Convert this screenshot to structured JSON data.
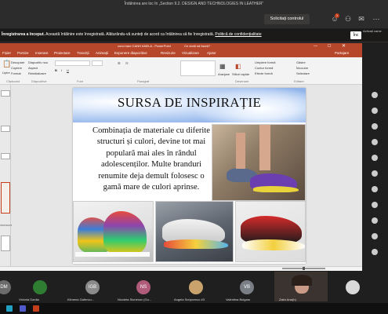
{
  "teams": {
    "meeting_title": "Întâlnirea are loc în „Section 9.2. DESIGN AND TECHNOLOGIES IN LEATHER”",
    "request_control_label": "Solicitați controlul",
    "notification_count": "1",
    "recording_banner": {
      "bold": "Înregistrarea a început.",
      "text": "Această întâlnire este înregistrată. Alăturându-vă sunteți de acord ca întâlnirea să fie înregistrată.",
      "link": "Politică de confidențialitate",
      "close_label": "Înc",
      "dismiss": "×"
    },
    "activate_label": "Activați came"
  },
  "powerpoint": {
    "title": "conc.hare CANH ANELA - PowerPoint",
    "window_search": "Ce doriți să faceți?",
    "user": "Partajare",
    "tabs": [
      "Fișier",
      "Pornire",
      "Inserare",
      "Proiectare",
      "Tranziții",
      "Animații",
      "Expunere diapozitive",
      "Revizuire",
      "Vizualizare",
      "Ajutor"
    ],
    "ribbon": {
      "paste": "Lipire",
      "clipboard_items": [
        "Decupare",
        "Copiere",
        "Format"
      ],
      "new_slide": "Diapozitiv nou",
      "slide_items": [
        "Aspect",
        "Reinițializare",
        "Secțiune"
      ],
      "group_clipboard": "Clipboard",
      "group_slides": "Diapozitive",
      "group_font": "Font",
      "group_paragraph": "Paragraf",
      "group_drawing": "Desenare",
      "group_editing": "Editare",
      "arrange": "Aranjare",
      "quick_styles": "Stiluri rapide",
      "shape_fill": "Umplere formă",
      "shape_outline": "Contur formă",
      "shape_effects": "Efecte formă",
      "find": "Găsire",
      "replace": "Înlocuire",
      "select": "Selectare"
    },
    "thumb_label": "INSPIRATIE",
    "slide": {
      "heading": "SURSA DE INSPIRAȚIE",
      "body": "Combinația de materiale cu diferite structuri și culori, devine tot mai populară mai ales  în rândul adolescenților. Multe branduri renumite deja demult folosesc o gamă mare de culori aprinse."
    }
  },
  "participants": [
    {
      "initials": "DM",
      "name": "",
      "color": "#6b6b6b"
    },
    {
      "initials": "",
      "name": "Victoria Danila",
      "color": "#2f7d32"
    },
    {
      "initials": "",
      "name": "",
      "color": "#1f1f1f"
    },
    {
      "initials": "IGB",
      "name": "Kilmena Gafencu...",
      "color": "#8a8a8a"
    },
    {
      "initials": "NS",
      "name": "Nicoleta Slonimov (Gu...",
      "color": "#b05b7a"
    },
    {
      "initials": "",
      "name": "Angela Scripcenco #3",
      "color": "#c9a36b"
    },
    {
      "initials": "VB",
      "name": "Valentina Bulgaru",
      "color": "#7a7f86"
    },
    {
      "initials": "",
      "name": "Zaim Ana(h)",
      "color": "#3a3330"
    }
  ],
  "colors": {
    "ppt_accent": "#b7472a",
    "teams_bg": "#1f1f1f",
    "topbar": "#2d2c2c"
  }
}
